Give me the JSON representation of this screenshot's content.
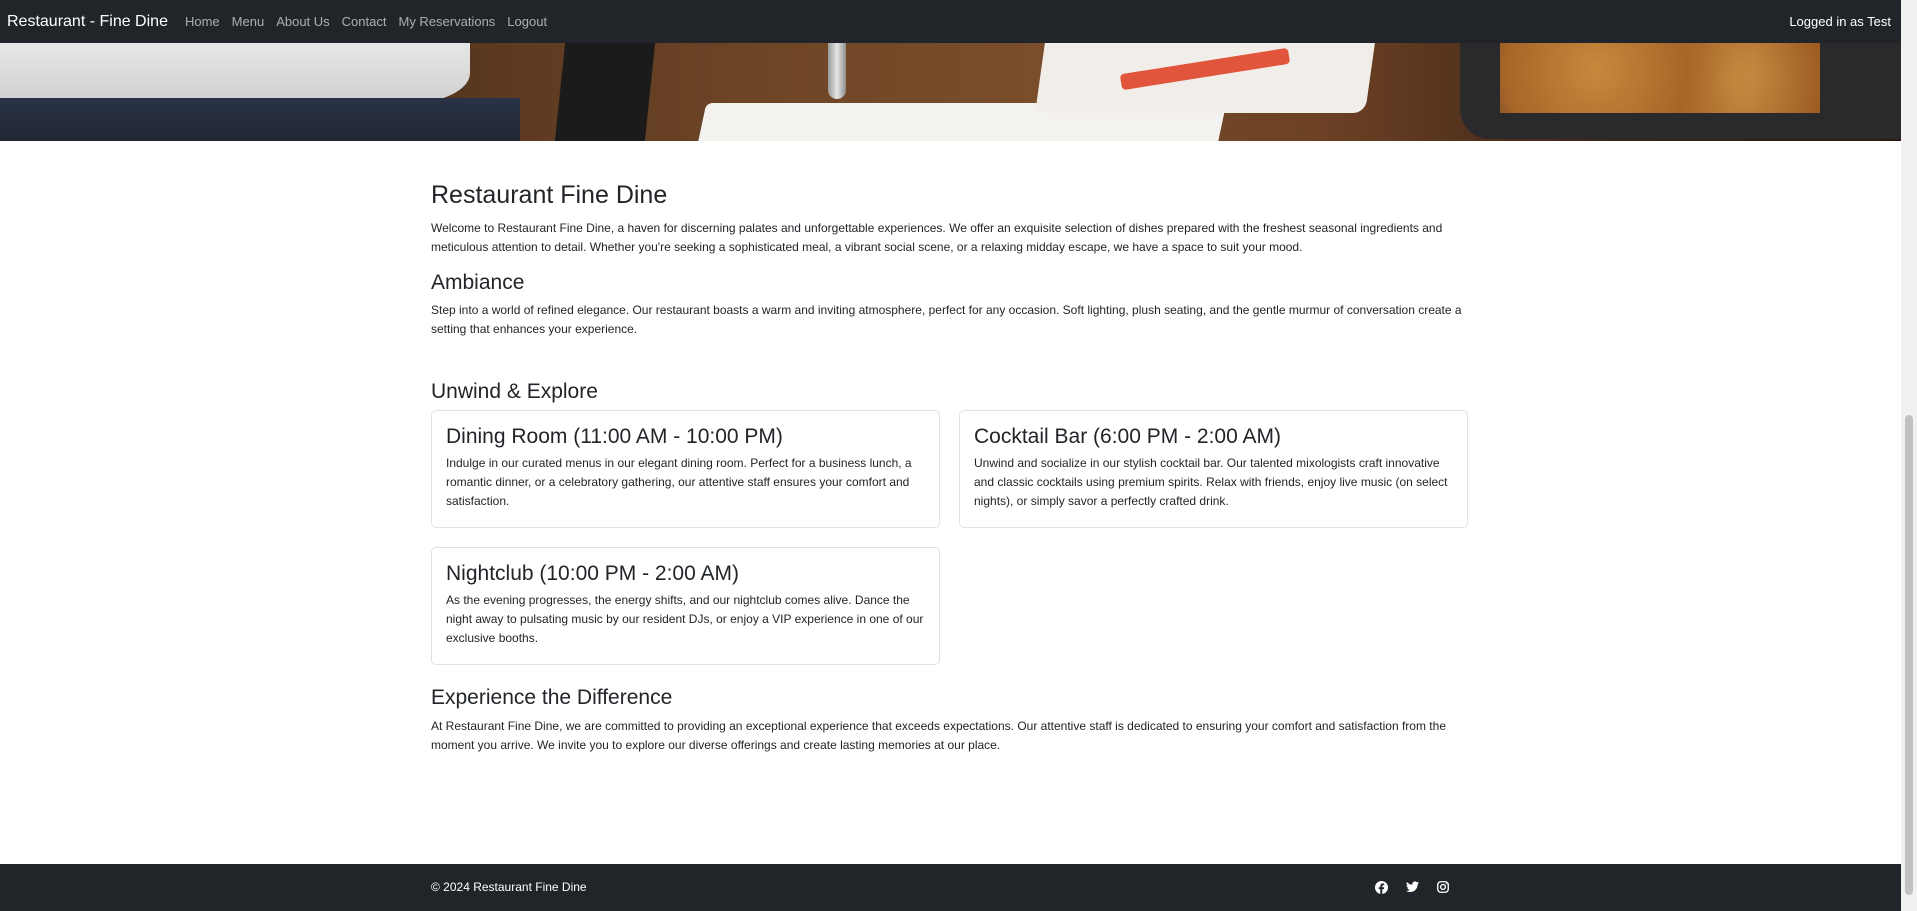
{
  "navbar": {
    "brand": "Restaurant - Fine Dine",
    "links": [
      "Home",
      "Menu",
      "About Us",
      "Contact",
      "My Reservations",
      "Logout"
    ],
    "status": "Logged in as Test"
  },
  "main": {
    "title": "Restaurant Fine Dine",
    "intro": "Welcome to Restaurant Fine Dine, a haven for discerning palates and unforgettable experiences. We offer an exquisite selection of dishes prepared with the freshest seasonal ingredients and meticulous attention to detail. Whether you're seeking a sophisticated meal, a vibrant social scene, or a relaxing midday escape, we have a space to suit your mood.",
    "ambiance": {
      "heading": "Ambiance",
      "text": "Step into a world of refined elegance. Our restaurant boasts a warm and inviting atmosphere, perfect for any occasion. Soft lighting, plush seating, and the gentle murmur of conversation create a setting that enhances your experience."
    },
    "unwind": {
      "heading": "Unwind & Explore",
      "cards": [
        {
          "title": "Dining Room (11:00 AM - 10:00 PM)",
          "text": "Indulge in our curated menus in our elegant dining room. Perfect for a business lunch, a romantic dinner, or a celebratory gathering, our attentive staff ensures your comfort and satisfaction."
        },
        {
          "title": "Cocktail Bar (6:00 PM - 2:00 AM)",
          "text": "Unwind and socialize in our stylish cocktail bar. Our talented mixologists craft innovative and classic cocktails using premium spirits. Relax with friends, enjoy live music (on select nights), or simply savor a perfectly crafted drink."
        },
        {
          "title": "Nightclub (10:00 PM - 2:00 AM)",
          "text": "As the evening progresses, the energy shifts, and our nightclub comes alive. Dance the night away to pulsating music by our resident DJs, or enjoy a VIP experience in one of our exclusive booths."
        }
      ]
    },
    "experience": {
      "heading": "Experience the Difference",
      "text": "At Restaurant Fine Dine, we are committed to providing an exceptional experience that exceeds expectations. Our attentive staff is dedicated to ensuring your comfort and satisfaction from the moment you arrive. We invite you to explore our diverse offerings and create lasting memories at our place."
    }
  },
  "footer": {
    "copyright": "© 2024 Restaurant Fine Dine",
    "icons": [
      "facebook-icon",
      "twitter-icon",
      "instagram-icon"
    ]
  },
  "colors": {
    "navbar_bg": "#212529",
    "footer_bg": "#212529",
    "card_border": "#dee2e6",
    "text": "#212529"
  }
}
